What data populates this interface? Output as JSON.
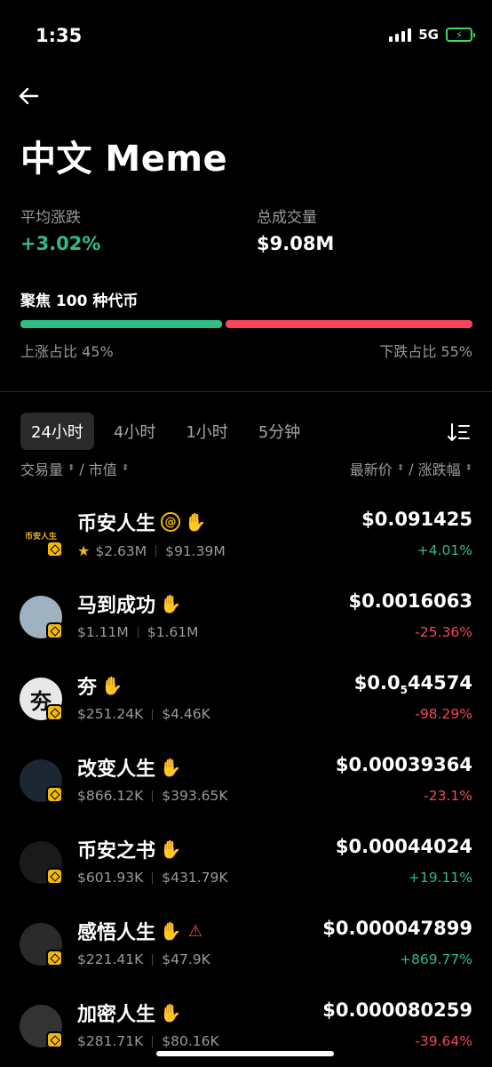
{
  "status": {
    "time": "1:35",
    "network": "5G"
  },
  "header": {
    "title": "中文 Meme"
  },
  "stats": {
    "avg_change_label": "平均涨跌",
    "avg_change_value": "+3.02%",
    "volume_label": "总成交量",
    "volume_value": "$9.08M"
  },
  "focus": {
    "label": "聚焦 100 种代币",
    "up_label": "上涨占比 45%",
    "down_label": "下跌占比 55%",
    "up_ratio": 0.45,
    "down_ratio": 0.55
  },
  "tabs": [
    "24小时",
    "4小时",
    "1小时",
    "5分钟"
  ],
  "active_tab": "24小时",
  "columns": {
    "left_a": "交易量",
    "left_sep": "/",
    "left_b": "市值",
    "right_a": "最新价",
    "right_sep": "/",
    "right_b": "涨跌幅"
  },
  "tokens": [
    {
      "name": "币安人生",
      "volume": "$2.63M",
      "mcap": "$91.39M",
      "price": "$0.091425",
      "change": "+4.01%",
      "dir": "up",
      "avatar_text": "币安人生",
      "avatar_bg": "#000000",
      "avatar_fg": "#f0b90b"
    },
    {
      "name": "马到成功",
      "volume": "$1.11M",
      "mcap": "$1.61M",
      "price": "$0.0016063",
      "change": "-25.36%",
      "dir": "down",
      "avatar_text": "",
      "avatar_bg": "#9eb2bf",
      "avatar_fg": "#ffffff"
    },
    {
      "name": "夯",
      "volume": "$251.24K",
      "mcap": "$4.46K",
      "price_main": "$0.0",
      "price_sub": "5",
      "price_tail": "44574",
      "change": "-98.29%",
      "dir": "down",
      "avatar_text": "夯",
      "avatar_bg": "#e8e8e8",
      "avatar_fg": "#111111"
    },
    {
      "name": "改变人生",
      "volume": "$866.12K",
      "mcap": "$393.65K",
      "price": "$0.00039364",
      "change": "-23.1%",
      "dir": "down",
      "avatar_text": "",
      "avatar_bg": "#1c2733",
      "avatar_fg": "#ffffff"
    },
    {
      "name": "币安之书",
      "volume": "$601.93K",
      "mcap": "$431.79K",
      "price": "$0.00044024",
      "change": "+19.11%",
      "dir": "up",
      "avatar_text": "",
      "avatar_bg": "#1a1a1a",
      "avatar_fg": "#f0b90b"
    },
    {
      "name": "感悟人生",
      "volume": "$221.41K",
      "mcap": "$47.9K",
      "price": "$0.000047899",
      "change": "+869.77%",
      "dir": "up",
      "avatar_text": "",
      "avatar_bg": "#2a2a2a",
      "avatar_fg": "#f0b90b"
    },
    {
      "name": "加密人生",
      "volume": "$281.71K",
      "mcap": "$80.16K",
      "price": "$0.000080259",
      "change": "-39.64%",
      "dir": "down",
      "avatar_text": "",
      "avatar_bg": "#333333",
      "avatar_fg": "#f0b90b"
    }
  ]
}
